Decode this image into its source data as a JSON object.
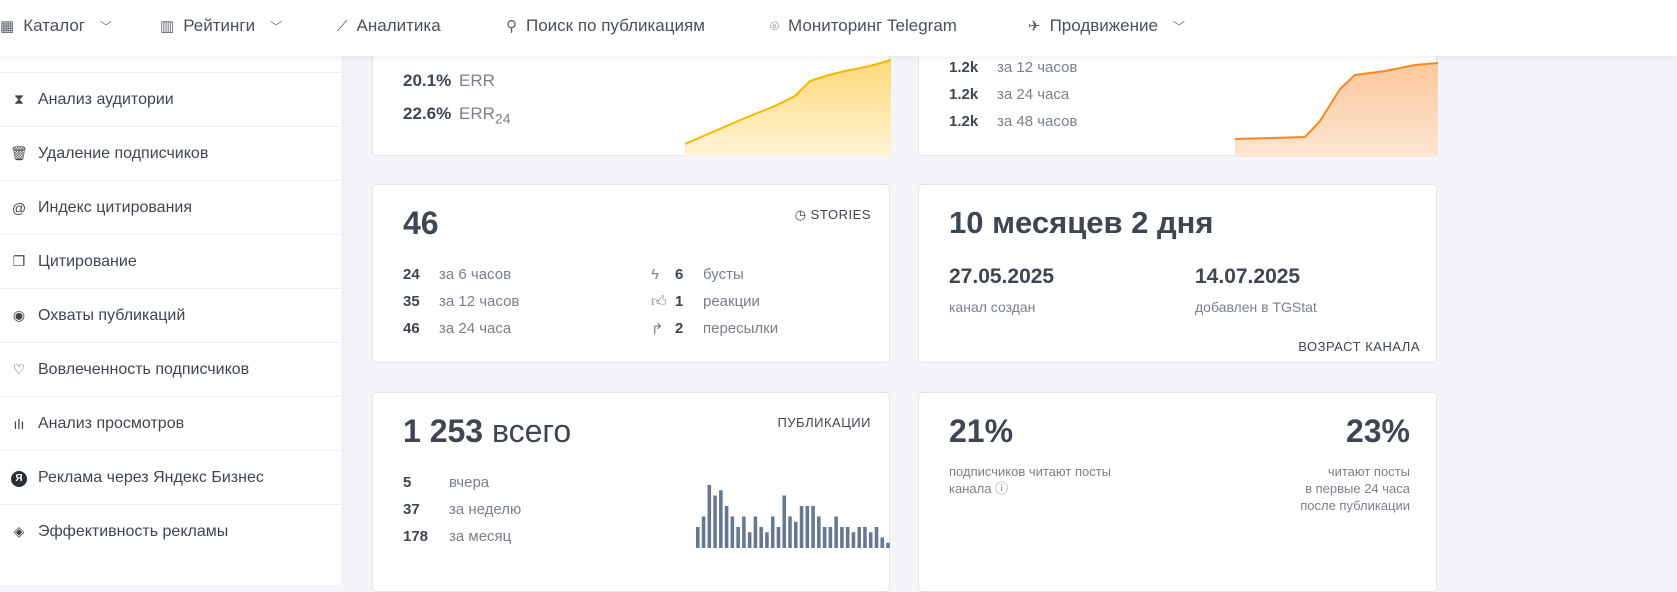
{
  "nav": [
    {
      "label": "Каталог",
      "icon": "grid-icon",
      "chevron": true
    },
    {
      "label": "Рейтинги",
      "icon": "bar-chart-icon",
      "chevron": true
    },
    {
      "label": "Аналитика",
      "icon": "line-chart-icon",
      "chevron": false
    },
    {
      "label": "Поиск по публикациям",
      "icon": "search-icon",
      "chevron": false
    },
    {
      "label": "Мониторинг Telegram",
      "icon": "monitor-icon",
      "chevron": false
    },
    {
      "label": "Продвижение",
      "icon": "rocket-icon",
      "chevron": true
    }
  ],
  "sidebar": [
    {
      "label": "Анализ аудитории",
      "icon": "hourglass-icon"
    },
    {
      "label": "Удаление подписчиков",
      "icon": "trash-icon"
    },
    {
      "label": "Индекс цитирования",
      "icon": "at-icon"
    },
    {
      "label": "Цитирование",
      "icon": "quote-icon"
    },
    {
      "label": "Охваты публикаций",
      "icon": "eye-icon"
    },
    {
      "label": "Вовлеченность подписчиков",
      "icon": "heart-icon"
    },
    {
      "label": "Анализ просмотров",
      "icon": "bars-icon"
    },
    {
      "label": "Реклама через Яндекс Бизнес",
      "icon": "yandex-icon"
    },
    {
      "label": "Эффективность рекламы",
      "icon": "target-icon"
    }
  ],
  "err": {
    "rows": [
      {
        "value": "20.1%",
        "label": "ERR"
      },
      {
        "value": "22.6%",
        "label": "ERR",
        "sub": "24"
      }
    ]
  },
  "reach": {
    "rows": [
      {
        "value": "1.2k",
        "label": "за 12 часов"
      },
      {
        "value": "1.2k",
        "label": "за 24 часа"
      },
      {
        "value": "1.2k",
        "label": "за 48 часов"
      }
    ]
  },
  "stories": {
    "total": "46",
    "title": "STORIES",
    "rows": [
      {
        "value": "24",
        "label": "за 6 часов"
      },
      {
        "value": "35",
        "label": "за 12 часов"
      },
      {
        "value": "46",
        "label": "за 24 часа"
      }
    ],
    "right": [
      {
        "value": "6",
        "label": "бусты",
        "icon": "bolt-icon"
      },
      {
        "value": "1",
        "label": "реакции",
        "icon": "thumb-up-icon"
      },
      {
        "value": "2",
        "label": "пересылки",
        "icon": "forward-icon"
      }
    ]
  },
  "age": {
    "title": "10 месяцев 2 дня",
    "created": "27.05.2025",
    "created_label": "канал создан",
    "added": "14.07.2025",
    "added_label": "добавлен в TGStat",
    "footer": "ВОЗРАСТ КАНАЛА"
  },
  "posts": {
    "total": "1 253",
    "total_suffix": "всего",
    "title": "ПУБЛИКАЦИИ",
    "rows": [
      {
        "value": "5",
        "label": "вчера"
      },
      {
        "value": "37",
        "label": "за неделю"
      },
      {
        "value": "178",
        "label": "за месяц"
      }
    ]
  },
  "reading": {
    "left_value": "21%",
    "left_label": "подписчиков читают посты канала",
    "right_value": "23%",
    "right_label1": "читают посты",
    "right_label2": "в первые 24 часа",
    "right_label3": "после публикации"
  },
  "chart_data": {
    "type": "bar",
    "values": [
      4,
      6,
      12,
      10,
      11,
      8,
      6,
      4,
      6,
      3,
      6,
      4,
      3,
      6,
      4,
      10,
      6,
      5,
      8,
      8,
      8,
      6,
      4,
      4,
      6,
      4,
      4,
      3,
      4,
      4,
      3,
      4,
      2,
      1
    ]
  },
  "colors": {
    "err": "#f5b800",
    "reach": "#f78a1d",
    "bars": "#66788f"
  }
}
